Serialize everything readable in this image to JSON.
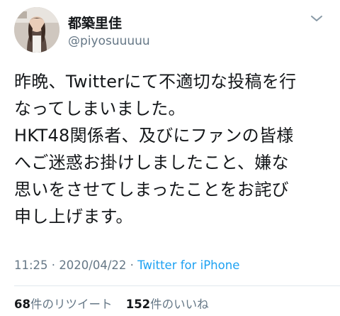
{
  "tweet": {
    "display_name": "都築里佳",
    "handle": "@piyosuuuuu",
    "text": "昨晩、Twitterにて不適切な投稿を行\nなってしまいました。\nHKT48関係者、及びにファンの皆様\nへご迷惑お掛けしましたこと、嫌な\n思いをさせてしまったことをお詫び\n申し上げます。",
    "time": "11:25",
    "separator": " · ",
    "date": "2020/04/22",
    "source": "Twitter for iPhone",
    "retweet_count": "68",
    "retweet_label": "件のリツイート",
    "like_count": "152",
    "like_label": "件のいいね"
  },
  "icons": {
    "avatar": "profile-photo",
    "menu": "chevron-down-icon"
  },
  "colors": {
    "text": "#14171a",
    "secondary": "#657786",
    "link": "#1da1f2",
    "divider": "#e1e8ed"
  }
}
